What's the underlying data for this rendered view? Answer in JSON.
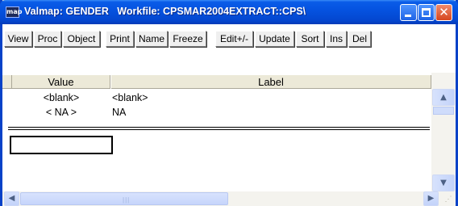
{
  "window": {
    "app_icon": "map",
    "title": "Valmap: GENDER   Workfile: CPSMAR2004EXTRACT::CPS\\",
    "controls": {
      "minimize": "minimize-icon",
      "maximize": "maximize-icon",
      "close": "✕"
    }
  },
  "toolbar": {
    "buttons": [
      {
        "label": "View"
      },
      {
        "label": "Proc"
      },
      {
        "label": "Object"
      },
      {
        "label": "Print"
      },
      {
        "label": "Name"
      },
      {
        "label": "Freeze"
      },
      {
        "label": "Edit+/-"
      },
      {
        "label": "Update"
      },
      {
        "label": "Sort"
      },
      {
        "label": "Ins"
      },
      {
        "label": "Del"
      }
    ]
  },
  "grid": {
    "columns": [
      "Value",
      "Label"
    ],
    "rows": [
      {
        "value": "<blank>",
        "label": "<blank>"
      },
      {
        "value": "< NA >",
        "label": "NA"
      }
    ]
  },
  "scroll": {
    "up": "▲",
    "down": "▼",
    "left": "◀",
    "right": "▶",
    "grip": "|||",
    "sizegrip": "⋰"
  }
}
